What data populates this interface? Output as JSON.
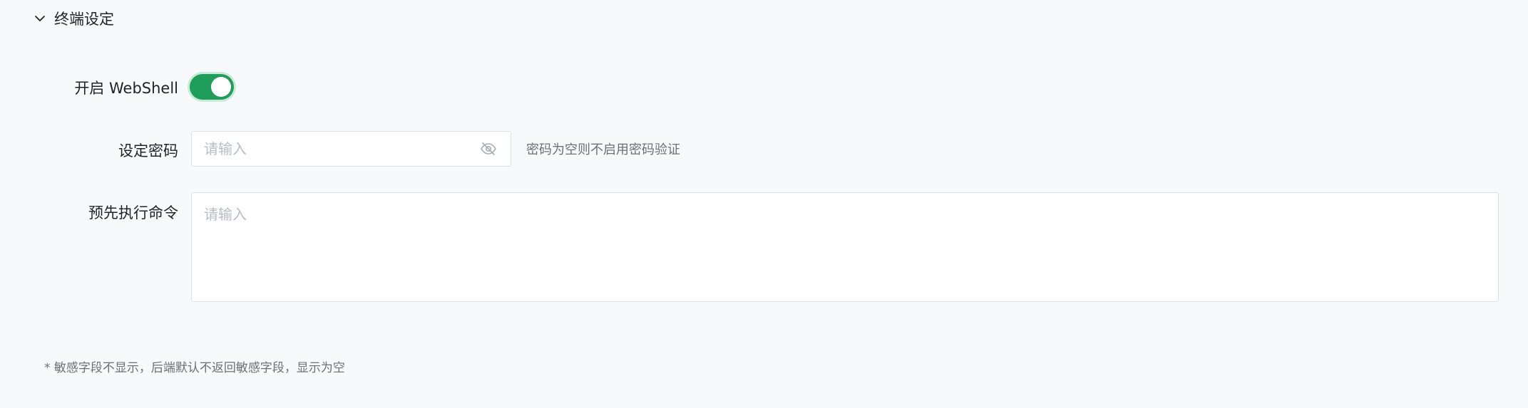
{
  "section": {
    "title": "终端设定",
    "icon": "chevron-down-icon",
    "expanded": true
  },
  "webshell": {
    "label": "开启 WebShell",
    "enabled": true,
    "accent_color": "#1e9e5a"
  },
  "password": {
    "label": "设定密码",
    "placeholder": "请输入",
    "value": "",
    "toggle_icon": "eye-off-icon",
    "hint": "密码为空则不启用密码验证"
  },
  "pre_command": {
    "label": "预先执行命令",
    "placeholder": "请输入",
    "value": ""
  },
  "footnote": "* 敏感字段不显示，后端默认不返回敏感字段，显示为空"
}
